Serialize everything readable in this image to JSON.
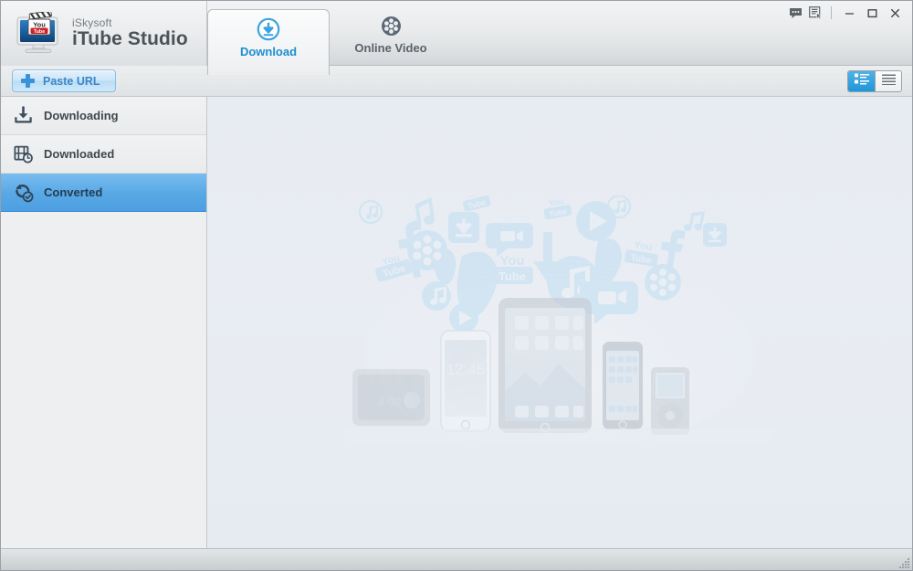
{
  "window": {
    "brand_sub": "iSkysoft",
    "brand_title": "iTube Studio",
    "logo_icon": "itube-studio-logo-icon",
    "extra_buttons": [
      {
        "name": "feedback-icon",
        "label": "Feedback"
      },
      {
        "name": "activity-log-icon",
        "label": "Activity Log"
      }
    ],
    "controls": [
      {
        "name": "minimize-button",
        "label": "Minimize",
        "glyph": "minimize"
      },
      {
        "name": "maximize-button",
        "label": "Maximize",
        "glyph": "maximize"
      },
      {
        "name": "close-button",
        "label": "Close",
        "glyph": "close"
      }
    ]
  },
  "tabs": [
    {
      "label": "Download",
      "icon": "download-circle-icon",
      "active": true
    },
    {
      "label": "Online Video",
      "icon": "film-reel-icon",
      "active": false
    }
  ],
  "toolbar": {
    "paste_url_label": "Paste URL",
    "paste_url_icon": "plus-icon",
    "views": [
      {
        "name": "thumbnail-view-button",
        "icon": "thumbnail-list-icon",
        "active": true
      },
      {
        "name": "list-view-button",
        "icon": "list-lines-icon",
        "active": false
      }
    ]
  },
  "sidebar": {
    "items": [
      {
        "label": "Downloading",
        "icon": "download-tray-icon",
        "selected": false
      },
      {
        "label": "Downloaded",
        "icon": "film-clock-icon",
        "selected": false
      },
      {
        "label": "Converted",
        "icon": "convert-check-icon",
        "selected": true
      }
    ]
  },
  "content": {
    "watermark_name": "devices-media-watermark",
    "empty_text": ""
  },
  "statusbar": {
    "text": "",
    "resize_grip": "resize-grip-icon"
  },
  "colors": {
    "accent_blue": "#1a8fd0",
    "selected_blue": "#5aa9e6",
    "title_bg": "#e9ebec",
    "content_bg": "#e8edf2",
    "sidebar_bg": "#edeff0",
    "text_dark": "#3f474d"
  }
}
